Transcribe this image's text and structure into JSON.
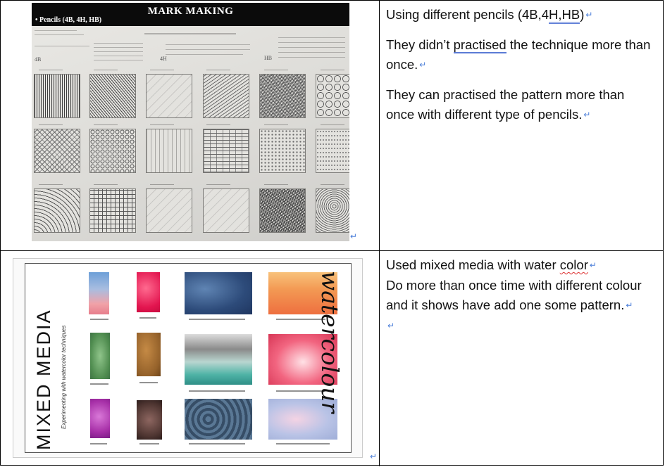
{
  "row1": {
    "image": {
      "title": "MARK MAKING",
      "subtitle": "Pencils (4B, 4H, HB)",
      "pencil_labels": [
        "4B",
        "4H",
        "HB"
      ],
      "colors": {
        "header": "#0b0b0b",
        "paper": "#e3e2de"
      }
    },
    "text": {
      "line1_prefix": "Using different pencils (4B,4",
      "line1_u1": "H,HB",
      "line1_suffix": ")",
      "p2_prefix": "They didn’t ",
      "p2_underlined": "practised",
      "p2_suffix": " the technique more than once.",
      "p3": "They can practised the pattern more than once with different type of pencils."
    }
  },
  "row2": {
    "image": {
      "title": "MIXED MEDIA",
      "subtitle": "Experimenting with watercolor techniques",
      "side_word": "watercolour",
      "colors": {
        "swatches": [
          "#7ea9d8",
          "#e8336b",
          "#3b5c8c",
          "#f39a54",
          "#6fa36a",
          "#a9732f",
          "#8fbfb5",
          "#e44d6b",
          "#a62fa7",
          "#5a3e3a",
          "#4d6a82",
          "#c4c7e4"
        ]
      }
    },
    "text": {
      "line1_prefix": "Used mixed media with water ",
      "line1_wavy": "color",
      "line2": "Do more than once time with different colour and it shows have add one some pattern."
    }
  },
  "return_mark": "↵"
}
